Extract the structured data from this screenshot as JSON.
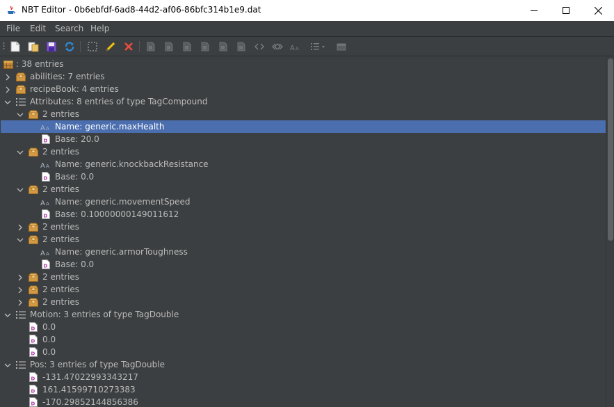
{
  "window": {
    "title": "NBT Editor - 0b6ebfdf-6ad8-44d2-af06-86bfc314b1e9.dat",
    "icon": "java-cup-icon"
  },
  "menu": [
    {
      "label": "File"
    },
    {
      "label": "Edit"
    },
    {
      "label": "Search"
    },
    {
      "label": "Help"
    }
  ],
  "toolbar": {
    "buttons": [
      {
        "name": "new-file-button",
        "icon": "new-file-icon"
      },
      {
        "name": "open-file-button",
        "icon": "open-folder-icon"
      },
      {
        "name": "save-button",
        "icon": "save-icon"
      },
      {
        "name": "refresh-button",
        "icon": "refresh-icon"
      },
      {
        "name": "select-button",
        "icon": "select-icon"
      },
      {
        "name": "edit-button",
        "icon": "pencil-icon"
      },
      {
        "name": "delete-button",
        "icon": "delete-icon"
      },
      {
        "name": "add-byte-button",
        "icon": "tag-icon"
      },
      {
        "name": "add-short-button",
        "icon": "tag-icon"
      },
      {
        "name": "add-int-button",
        "icon": "tag-icon"
      },
      {
        "name": "add-long-button",
        "icon": "tag-icon"
      },
      {
        "name": "add-float-button",
        "icon": "tag-icon"
      },
      {
        "name": "add-double-button",
        "icon": "tag-icon"
      },
      {
        "name": "add-byte-array-button",
        "icon": "angle-brackets-icon"
      },
      {
        "name": "add-int-array-button",
        "icon": "double-angle-icon"
      },
      {
        "name": "add-string-button",
        "icon": "string-icon"
      },
      {
        "name": "add-list-button",
        "icon": "list-icon"
      },
      {
        "name": "add-compound-button",
        "icon": "compound-icon"
      }
    ],
    "colors": {
      "accent_blue": "#4b6eaf",
      "delete_red": "#e84c3d",
      "pencil_yellow": "#f0c419",
      "refresh_blue": "#2d8cd8"
    }
  },
  "tree": {
    "rows": [
      {
        "depth": 0,
        "arrow": "none",
        "icon": "compound-root-icon",
        "label": ": 38 entries"
      },
      {
        "depth": 0,
        "arrow": "collapsed",
        "icon": "compound-icon",
        "label": "abilities: 7 entries"
      },
      {
        "depth": 0,
        "arrow": "collapsed",
        "icon": "compound-icon",
        "label": "recipeBook: 4 entries"
      },
      {
        "depth": 0,
        "arrow": "expanded",
        "icon": "list-icon",
        "label": "Attributes: 8 entries of type TagCompound"
      },
      {
        "depth": 1,
        "arrow": "expanded",
        "icon": "compound-icon",
        "label": "2 entries"
      },
      {
        "depth": 2,
        "arrow": "none",
        "icon": "string-icon",
        "label": "Name: generic.maxHealth",
        "selected": true
      },
      {
        "depth": 2,
        "arrow": "none",
        "icon": "double-icon",
        "label": "Base: 20.0"
      },
      {
        "depth": 1,
        "arrow": "expanded",
        "icon": "compound-icon",
        "label": "2 entries"
      },
      {
        "depth": 2,
        "arrow": "none",
        "icon": "string-icon",
        "label": "Name: generic.knockbackResistance"
      },
      {
        "depth": 2,
        "arrow": "none",
        "icon": "double-icon",
        "label": "Base: 0.0"
      },
      {
        "depth": 1,
        "arrow": "expanded",
        "icon": "compound-icon",
        "label": "2 entries"
      },
      {
        "depth": 2,
        "arrow": "none",
        "icon": "string-icon",
        "label": "Name: generic.movementSpeed"
      },
      {
        "depth": 2,
        "arrow": "none",
        "icon": "double-icon",
        "label": "Base: 0.10000000149011612"
      },
      {
        "depth": 1,
        "arrow": "collapsed",
        "icon": "compound-icon",
        "label": "2 entries"
      },
      {
        "depth": 1,
        "arrow": "expanded",
        "icon": "compound-icon",
        "label": "2 entries"
      },
      {
        "depth": 2,
        "arrow": "none",
        "icon": "string-icon",
        "label": "Name: generic.armorToughness"
      },
      {
        "depth": 2,
        "arrow": "none",
        "icon": "double-icon",
        "label": "Base: 0.0"
      },
      {
        "depth": 1,
        "arrow": "collapsed",
        "icon": "compound-icon",
        "label": "2 entries"
      },
      {
        "depth": 1,
        "arrow": "collapsed",
        "icon": "compound-icon",
        "label": "2 entries"
      },
      {
        "depth": 1,
        "arrow": "collapsed",
        "icon": "compound-icon",
        "label": "2 entries"
      },
      {
        "depth": 0,
        "arrow": "expanded",
        "icon": "list-icon",
        "label": "Motion: 3 entries of type TagDouble"
      },
      {
        "depth": 1,
        "arrow": "none",
        "icon": "double-icon",
        "label": "0.0"
      },
      {
        "depth": 1,
        "arrow": "none",
        "icon": "double-icon",
        "label": "0.0"
      },
      {
        "depth": 1,
        "arrow": "none",
        "icon": "double-icon",
        "label": "0.0"
      },
      {
        "depth": 0,
        "arrow": "expanded",
        "icon": "list-icon",
        "label": "Pos: 3 entries of type TagDouble"
      },
      {
        "depth": 1,
        "arrow": "none",
        "icon": "double-icon",
        "label": "-131.47022993343217"
      },
      {
        "depth": 1,
        "arrow": "none",
        "icon": "double-icon",
        "label": "161.41599710273383"
      },
      {
        "depth": 1,
        "arrow": "none",
        "icon": "double-icon",
        "label": "-170.29852144856386"
      }
    ]
  }
}
